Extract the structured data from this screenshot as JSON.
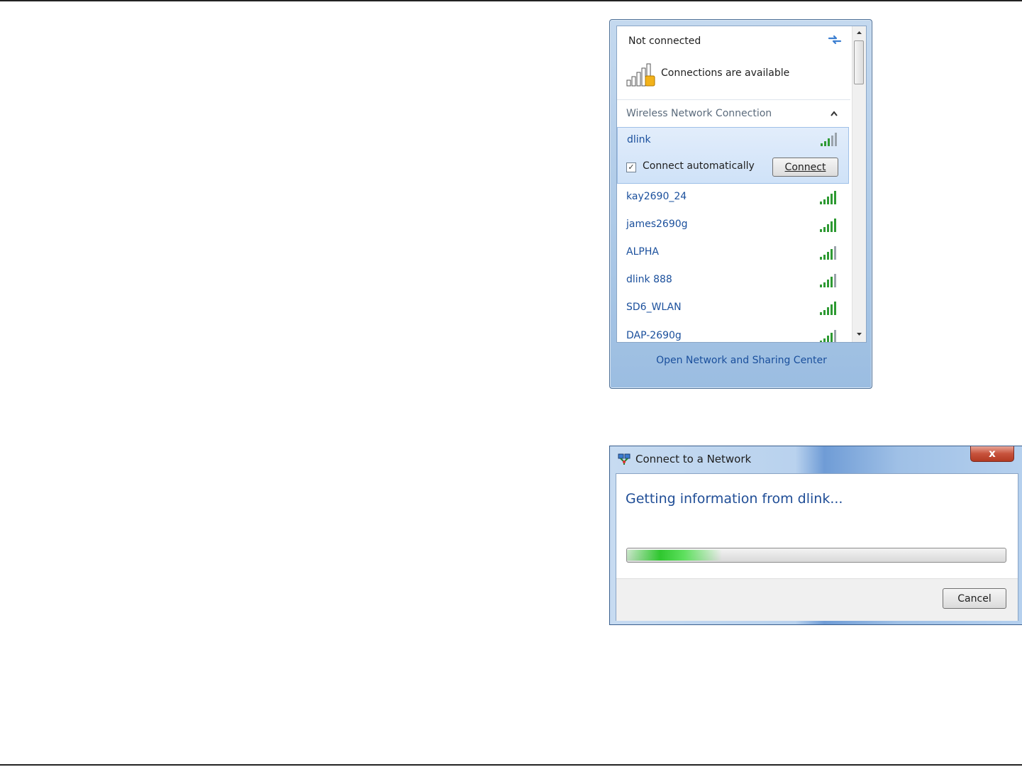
{
  "network_flyout": {
    "status": "Not connected",
    "availability": "Connections are available",
    "section": "Wireless Network Connection",
    "selected_network": {
      "name": "dlink",
      "connect_automatically_label": "Connect automatically",
      "connect_automatically_checked": true,
      "connect_button": "Connect"
    },
    "networks": [
      {
        "name": "kay2690_24"
      },
      {
        "name": "james2690g"
      },
      {
        "name": "ALPHA"
      },
      {
        "name": "dlink 888"
      },
      {
        "name": "SD6_WLAN"
      },
      {
        "name": "DAP-2690g"
      }
    ],
    "footer_link": "Open Network and Sharing Center",
    "icons": [
      "refresh-icon",
      "signal-bars-icon",
      "collapse-icon",
      "scroll-up-icon",
      "scroll-down-icon"
    ]
  },
  "connect_dialog": {
    "title": "Connect to a Network",
    "close_label": "x",
    "heading": "Getting information from dlink...",
    "progress": 0.25,
    "cancel_button": "Cancel",
    "colors": {
      "heading": "#1f4d96",
      "progress": "#2fc72f",
      "link": "#1a4f9c"
    }
  }
}
